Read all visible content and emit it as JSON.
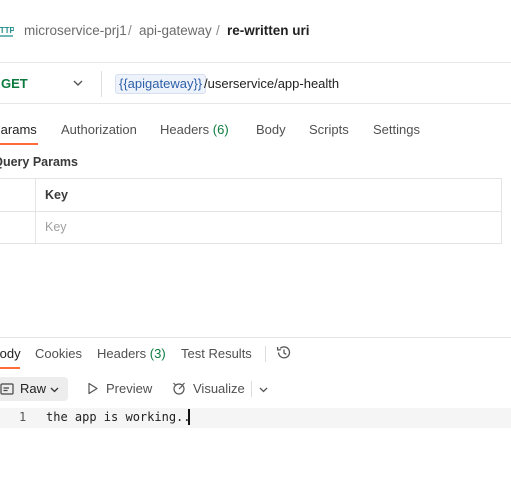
{
  "breadcrumb": {
    "protocol_badge": "HTTP",
    "collection": "microservice-prj1",
    "folder": "api-gateway",
    "request": "re-written uri",
    "separator": "/"
  },
  "request": {
    "method": "GET",
    "url_variable": "{{apigateway}}",
    "url_path": "/userservice/app-health"
  },
  "request_tabs": [
    {
      "label": "Params",
      "active": true
    },
    {
      "label": "Authorization"
    },
    {
      "label": "Headers",
      "count": "(6)"
    },
    {
      "label": "Body"
    },
    {
      "label": "Scripts"
    },
    {
      "label": "Settings"
    }
  ],
  "query_params": {
    "title": "Query Params",
    "key_header": "Key",
    "key_placeholder": "Key"
  },
  "response_tabs": [
    {
      "label": "Body",
      "active": true
    },
    {
      "label": "Cookies"
    },
    {
      "label": "Headers",
      "count": "(3)"
    },
    {
      "label": "Test Results"
    }
  ],
  "response_toolbar": {
    "format": "Raw",
    "preview": "Preview",
    "visualize": "Visualize"
  },
  "response_body": {
    "lines": [
      {
        "number": "1",
        "text": "the app is working.."
      }
    ]
  },
  "colors": {
    "accent": "#ff6c37",
    "method_get": "#0b7a3e",
    "variable": "#2d5fa8"
  }
}
